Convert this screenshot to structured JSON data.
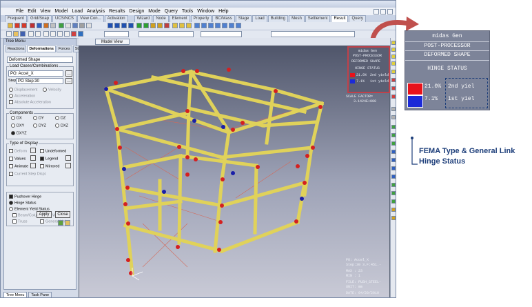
{
  "menubar": {
    "items": [
      "File",
      "Edit",
      "View",
      "Model",
      "Load",
      "Analysis",
      "Results",
      "Design",
      "Mode",
      "Query",
      "Tools",
      "Window",
      "Help"
    ]
  },
  "main_tabs": [
    "Frequent",
    "Grid/Snap",
    "UCS/NCS",
    "View Con...",
    "Activation",
    "Wizard",
    "Node",
    "Element",
    "Property",
    "BC/Mass",
    "Stage",
    "Load",
    "Building",
    "Mesh",
    "Settlement",
    "Result",
    "Query"
  ],
  "main_tabs_active": "Result",
  "tree_menu": {
    "title": "Tree Menu",
    "tabs": [
      "Reactions",
      "Deformations",
      "Forces",
      "Stresses"
    ],
    "active_tab": "Deformations",
    "result_type": "Deformed Shape",
    "load_cases_label": "Load Cases/Combinations",
    "load_case": "PO: Accel_X",
    "step_label": "Step",
    "step_value": "PO Step:30",
    "display_options": [
      "Displacement",
      "Velocity",
      "Acceleration",
      "Absolute Acceleration"
    ],
    "components_label": "Components",
    "components": [
      "DX",
      "DY",
      "DZ",
      "DXY",
      "DYZ",
      "DXZ",
      "DXYZ"
    ],
    "components_selected": "DXYZ",
    "type_of_display_label": "Type of Display",
    "display_items": [
      "Deform",
      "Undeformed",
      "Values",
      "Legend",
      "Animate",
      "Mirrored",
      "Current Step Displ."
    ],
    "pushover_hinge_label": "Pushover Hinge",
    "hinge_status_label": "Hinge Status",
    "element_yield_label": "Element Yield Status",
    "element_yield_items": [
      "Beam/Column",
      "Wall",
      "Truss",
      "General Link"
    ],
    "apply_label": "Apply",
    "close_label": "Close"
  },
  "bottom_tabs": [
    "Tree Menu",
    "Task Pane"
  ],
  "viewport": {
    "tab_label": "Model View"
  },
  "legend_small": {
    "lines": [
      "midas Gen",
      "POST-PROCESSOR",
      "DEFORMED SHAPE",
      "HINGE STATUS"
    ],
    "entries": [
      {
        "color": "#e8121b",
        "percent": "21.0%",
        "label": "2nd yield"
      },
      {
        "color": "#1b2ad8",
        "percent": "7.1%",
        "label": "1st yield"
      }
    ],
    "scale_label": "SCALE FACTOR=",
    "scale_value": "3.1424E+000"
  },
  "info_block": [
    "PO: Accel_X",
    "Step:30 3.F:451.-",
    "MAX : 23",
    "MIN : 1",
    "FILE: PUSH_STEEL-",
    "UNIT: mm",
    "DATE: 04/29/2010"
  ],
  "callout": {
    "line1": "midas Gen",
    "line2": "POST-PROCESSOR",
    "line3": "DEFORMED SHAPE",
    "line4": "HINGE STATUS",
    "entries": [
      {
        "color": "#e8121b",
        "percent": "21.0%",
        "label": "2nd yiel"
      },
      {
        "color": "#1b2ad8",
        "percent": "7.1%",
        "label": "1st yiel"
      }
    ]
  },
  "annotation": {
    "line1": "FEMA Type & General Link",
    "line2": "Hinge Status"
  },
  "colors": {
    "beam": "#e3d35a",
    "hinge_red": "#d42020",
    "hinge_blue": "#1a1fa8",
    "callout_arrow": "#c0504d"
  }
}
